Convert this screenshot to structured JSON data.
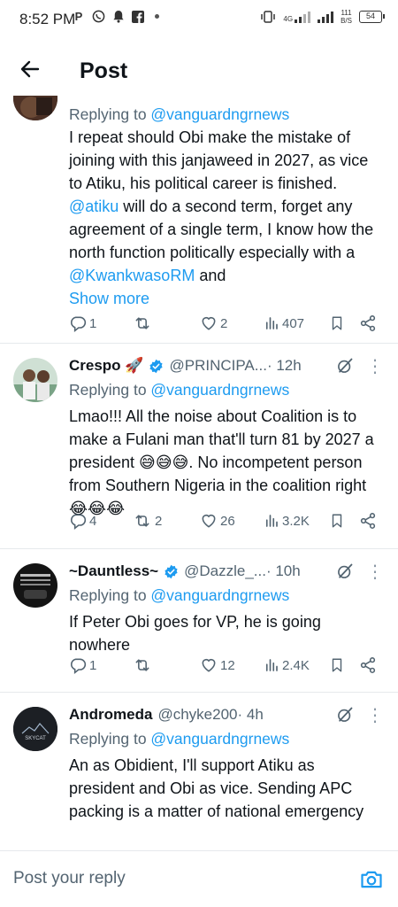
{
  "status_bar": {
    "time": "8:52 PM",
    "left_icons": [
      "P",
      "whatsapp-icon",
      "bell-icon",
      "facebook-icon"
    ],
    "network": "4G",
    "speed_top": "111",
    "speed_bottom": "B/S",
    "battery": "54"
  },
  "header": {
    "title": "Post"
  },
  "tweets": [
    {
      "name": "",
      "handle": "",
      "time": "",
      "replying_prefix": "Replying to ",
      "replying_to": "@vanguardngrnews",
      "body_parts": [
        "I repeat should Obi make the mistake of joining with this janjaweed in 2027, as vice to Atiku, his political career is finished. ",
        "@atiku",
        " will do a second term, forget any agreement of a single term, I know how the north function politically especially with a ",
        "@KwankwasoRM",
        " and"
      ],
      "show_more": "Show more",
      "replies": "1",
      "reposts": "",
      "likes": "2",
      "views": "407"
    },
    {
      "name": "Crespo 🚀",
      "handle": "@PRINCIPA...",
      "time": " · 12h",
      "replying_prefix": "Replying to ",
      "replying_to": "@vanguardngrnews",
      "body": "Lmao!!! All the noise about Coalition is to make a Fulani man that'll turn 81 by 2027 a president 😅😅😅. No incompetent person from Southern Nigeria in the coalition right 😂😂😂",
      "replies": "4",
      "reposts": "2",
      "likes": "26",
      "views": "3.2K"
    },
    {
      "name": "~Dauntless~",
      "handle": "@Dazzle_...",
      "time": " · 10h",
      "replying_prefix": "Replying to ",
      "replying_to": "@vanguardngrnews",
      "body": "If Peter Obi goes for VP, he is going nowhere",
      "replies": "1",
      "reposts": "",
      "likes": "12",
      "views": "2.4K"
    },
    {
      "name": "Andromeda",
      "handle": "@chyke200",
      "time": " · 4h",
      "replying_prefix": "Replying to ",
      "replying_to": "@vanguardngrnews",
      "body": "An as Obidient, I'll support Atiku as president and Obi as vice. Sending APC packing is a matter of national emergency",
      "avatar_text": "SKYCAT"
    }
  ],
  "reply_bar": {
    "placeholder": "Post your reply"
  },
  "colors": {
    "accent": "#1d9bf0",
    "text": "#0f1419",
    "muted": "#536471",
    "divider": "#e6e9ec"
  }
}
